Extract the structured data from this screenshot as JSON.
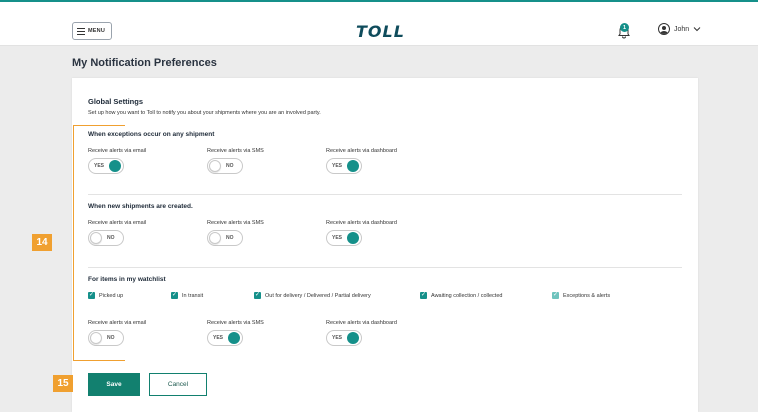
{
  "header": {
    "menu_label": "MENU",
    "logo_text": "TOLL",
    "notification_count": "1",
    "user_name": "John"
  },
  "page": {
    "title": "My Notification Preferences"
  },
  "global": {
    "title": "Global Settings",
    "description": "Set up how you want to Toll to notify you about your shipments where you are an involved party."
  },
  "labels": {
    "email": "Receive alerts via email",
    "sms": "Receive alerts via SMS",
    "dashboard": "Receive alerts via dashboard"
  },
  "sections": {
    "exceptions": {
      "title": "When exceptions occur on any shipment",
      "email": "YES",
      "sms": "NO",
      "dashboard": "YES"
    },
    "new_shipments": {
      "title": "When new shipments are created.",
      "email": "NO",
      "sms": "NO",
      "dashboard": "YES"
    },
    "watchlist": {
      "title": "For items in my watchlist",
      "items": [
        "Picked up",
        "In transit",
        "Out for delivery / Delivered / Partial delivery",
        "Awaiting collection / collected",
        "Exceptions & alerts"
      ],
      "email": "NO",
      "sms": "YES",
      "dashboard": "YES"
    }
  },
  "markers": [
    "14",
    "15"
  ],
  "buttons": {
    "save": "Save",
    "cancel": "Cancel"
  },
  "colors": {
    "accent": "#15908a",
    "marker": "#f0a030"
  },
  "icons": [
    "menu-icon",
    "bell-icon",
    "user-avatar-icon",
    "chevron-down-icon",
    "checkbox-checked-icon"
  ]
}
